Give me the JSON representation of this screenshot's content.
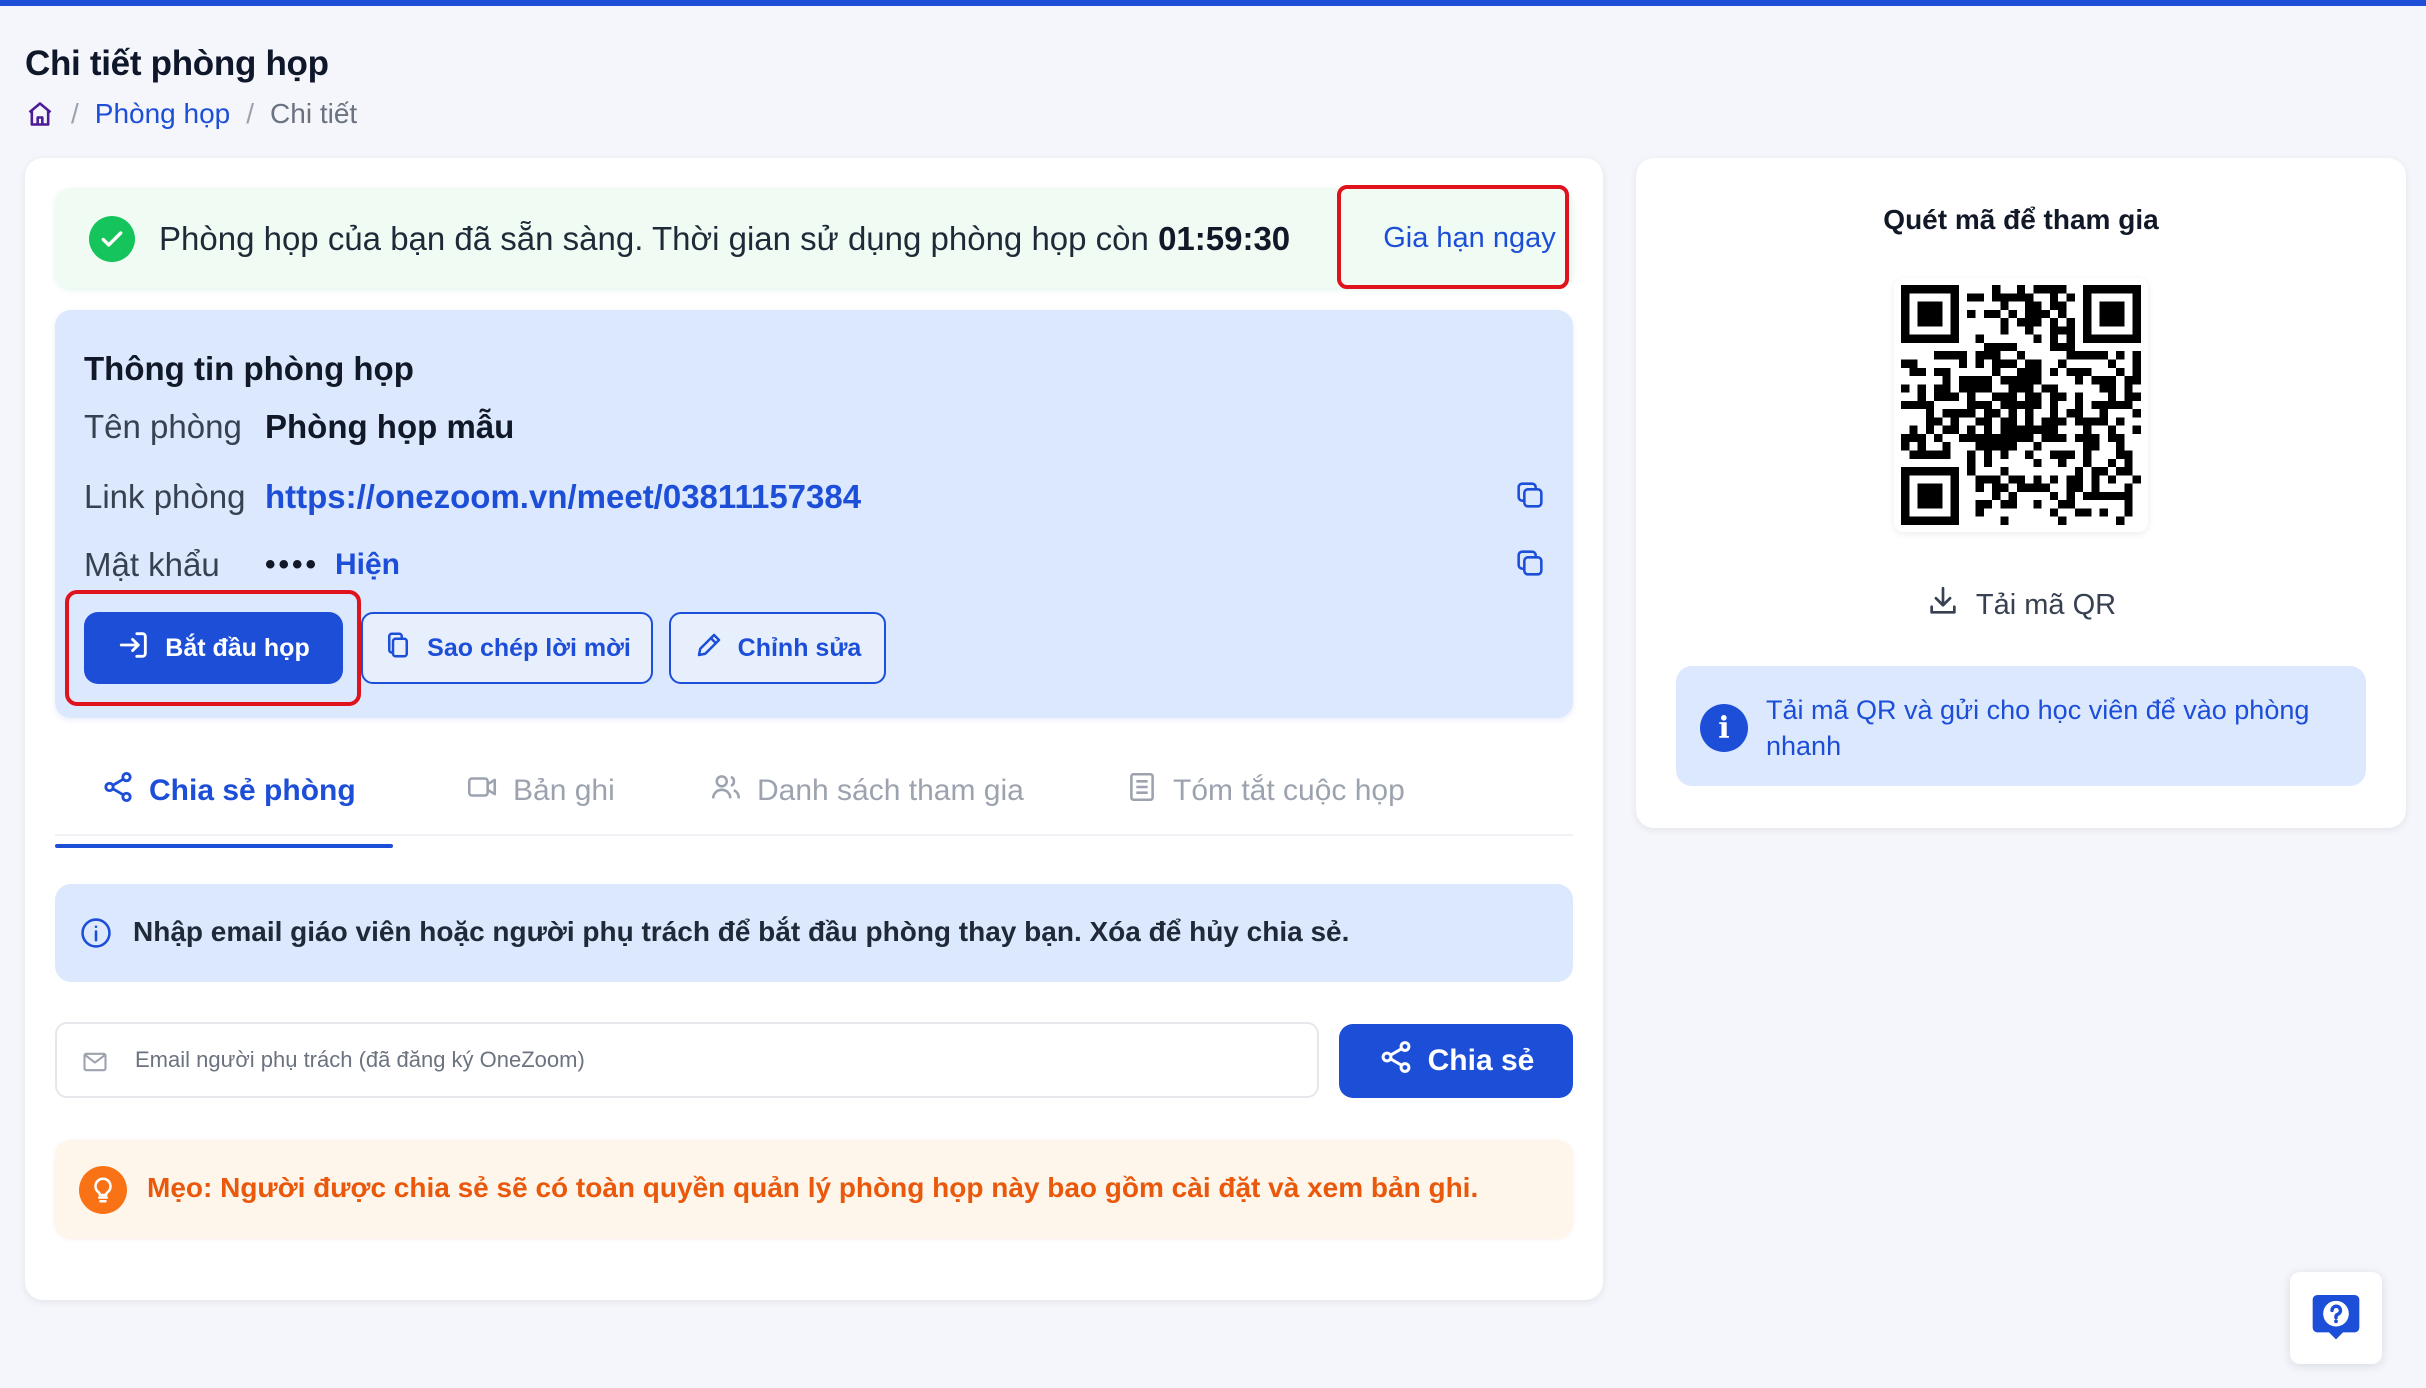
{
  "page": {
    "title": "Chi tiết phòng họp",
    "breadcrumb": {
      "home_icon": "home-icon",
      "items": [
        "Phòng họp",
        "Chi tiết"
      ]
    }
  },
  "ready_banner": {
    "message": "Phòng họp của bạn đã sẵn sàng. Thời gian sử dụng phòng họp còn",
    "time_remaining": "01:59:30",
    "extend_label": "Gia hạn ngay"
  },
  "room_info": {
    "title": "Thông tin phòng họp",
    "name_label": "Tên phòng",
    "name_value": "Phòng họp mẫu",
    "link_label": "Link phòng",
    "link_value": "https://onezoom.vn/meet/03811157384",
    "password_label": "Mật khẩu",
    "password_masked": "••••",
    "password_show": "Hiện"
  },
  "actions": {
    "start": "Bắt đầu họp",
    "copy_invite": "Sao chép lời mời",
    "edit": "Chỉnh sửa"
  },
  "tabs": [
    {
      "label": "Chia sẻ phòng",
      "icon": "share-icon",
      "active": true
    },
    {
      "label": "Bản ghi",
      "icon": "video-icon",
      "active": false
    },
    {
      "label": "Danh sách tham gia",
      "icon": "users-icon",
      "active": false
    },
    {
      "label": "Tóm tắt cuộc họp",
      "icon": "document-icon",
      "active": false
    }
  ],
  "share": {
    "notice": "Nhập email giáo viên hoặc người phụ trách để bắt đầu phòng thay bạn. Xóa để hủy chia sẻ.",
    "email_placeholder": "Email người phụ trách (đã đăng ký OneZoom)",
    "email_value": "",
    "share_button": "Chia sẻ",
    "tip": "Mẹo: Người được chia sẻ sẽ có toàn quyền quản lý phòng họp này bao gồm cài đặt và xem bản ghi."
  },
  "qr_panel": {
    "title": "Quét mã để tham gia",
    "download_label": "Tải mã QR",
    "note": "Tải mã QR và gửi cho học viên để vào phòng nhanh"
  },
  "colors": {
    "primary": "#1d4ed8",
    "success": "#16c45c",
    "warning": "#ea580c",
    "highlight": "#e0121b",
    "info_bg": "#dbe8fd"
  }
}
